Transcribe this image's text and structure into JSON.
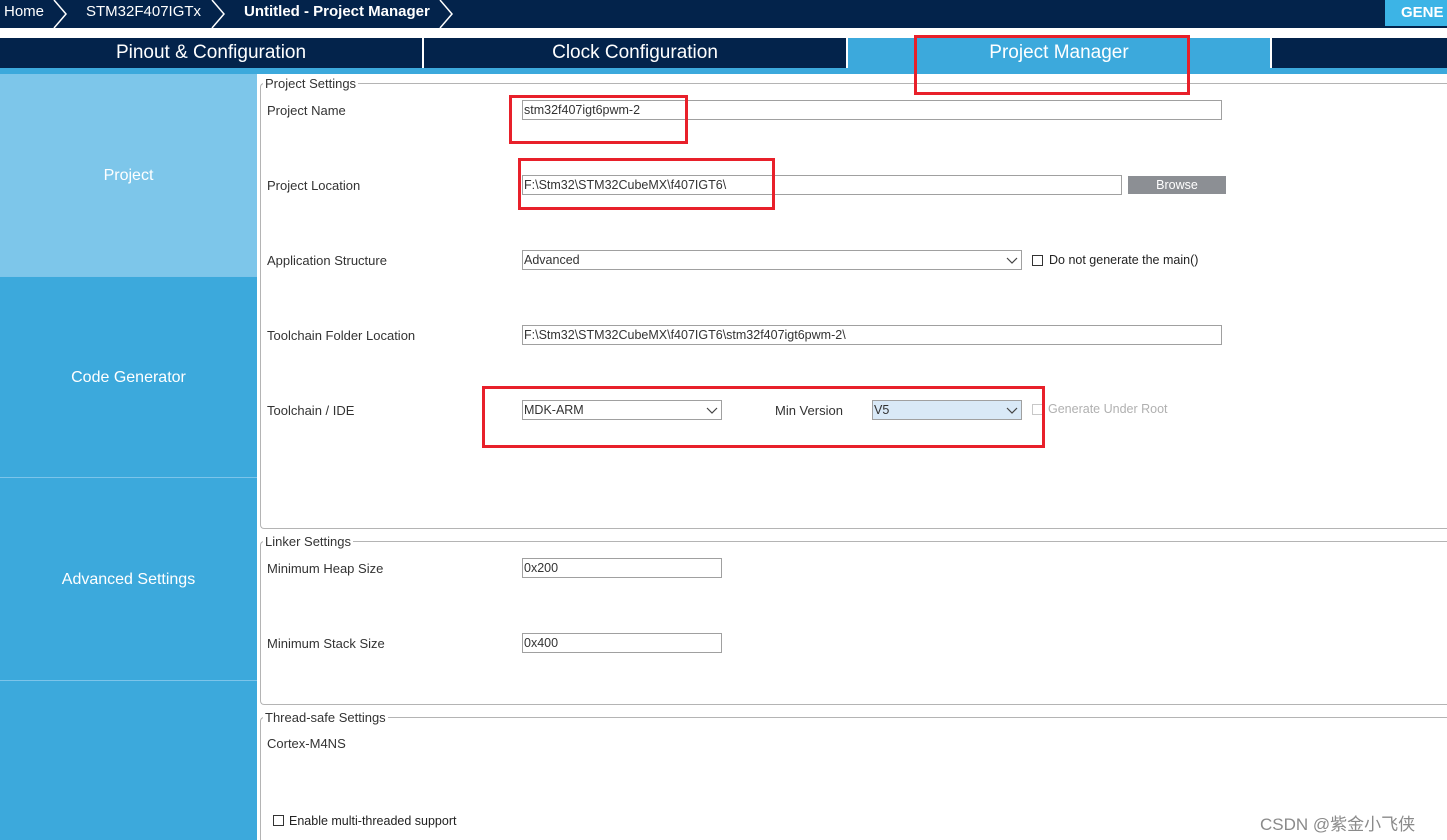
{
  "breadcrumb": {
    "home": "Home",
    "mcu": "STM32F407IGTx",
    "current": "Untitled - Project Manager"
  },
  "generate_button": "GENE",
  "tabs": {
    "pinout": "Pinout & Configuration",
    "clock": "Clock Configuration",
    "project_manager": "Project Manager"
  },
  "sidebar": {
    "items": [
      "Project",
      "Code Generator",
      "Advanced Settings"
    ],
    "active": "Project"
  },
  "project_settings": {
    "legend": "Project Settings",
    "project_name_label": "Project Name",
    "project_name_value": "stm32f407igt6pwm-2",
    "project_location_label": "Project Location",
    "project_location_value": "F:\\Stm32\\STM32CubeMX\\f407IGT6\\",
    "browse_label": "Browse",
    "app_structure_label": "Application Structure",
    "app_structure_value": "Advanced",
    "no_main_label": "Do not generate the main()",
    "toolchain_folder_label": "Toolchain Folder Location",
    "toolchain_folder_value": "F:\\Stm32\\STM32CubeMX\\f407IGT6\\stm32f407igt6pwm-2\\",
    "toolchain_label": "Toolchain / IDE",
    "toolchain_value": "MDK-ARM",
    "min_version_label": "Min Version",
    "min_version_value": "V5",
    "generate_root_label": "Generate Under Root"
  },
  "linker_settings": {
    "legend": "Linker Settings",
    "heap_label": "Minimum Heap Size",
    "heap_value": "0x200",
    "stack_label": "Minimum Stack Size",
    "stack_value": "0x400"
  },
  "thread_settings": {
    "legend": "Thread-safe Settings",
    "core": "Cortex-M4NS",
    "multithread_label": "Enable multi-threaded support"
  },
  "watermark": "CSDN @紫金小飞侠",
  "colors": {
    "navy": "#03234b",
    "blue": "#3ca9dc",
    "light_blue": "#7dc6ea",
    "annotation_red": "#e8202a"
  }
}
